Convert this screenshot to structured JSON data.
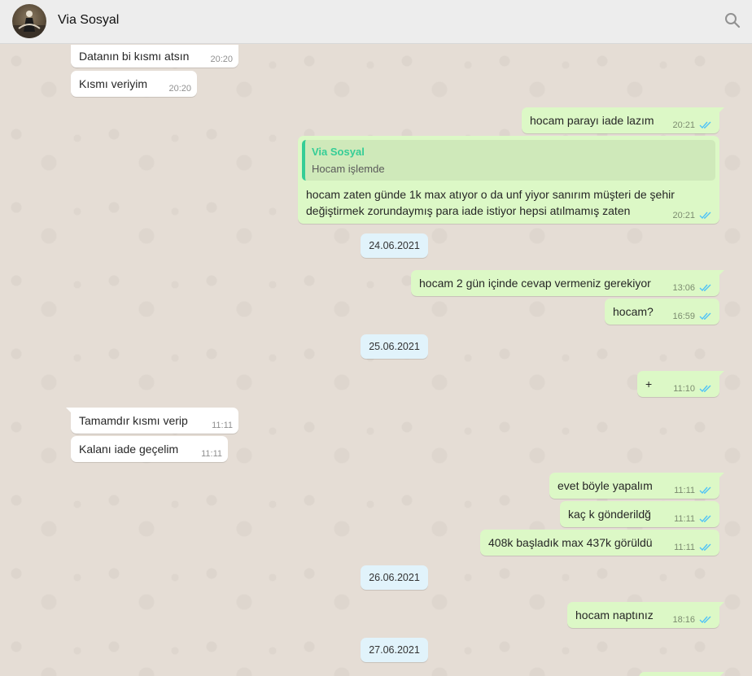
{
  "header": {
    "title": "Via Sosyal"
  },
  "messages": {
    "m1": {
      "text": "Datanın bi kısmı atsın",
      "time": "20:20"
    },
    "m2": {
      "text": "Kısmı veriyim",
      "time": "20:20"
    },
    "m3": {
      "text": "hocam parayı iade lazım",
      "time": "20:21"
    },
    "m4": {
      "quote_name": "Via Sosyal",
      "quote_text": "Hocam işlemde",
      "text": "hocam zaten günde 1k max atıyor o da unf yiyor sanırım müşteri de şehir değiştirmek zorundaymış para iade istiyor hepsi atılmamış zaten",
      "time": "20:21"
    },
    "m5": {
      "text": "hocam 2 gün içinde cevap vermeniz gerekiyor",
      "time": "13:06"
    },
    "m6": {
      "text": "hocam?",
      "time": "16:59"
    },
    "m7": {
      "text": "+",
      "time": "11:10"
    },
    "m8": {
      "text": "Tamamdır kısmı verip",
      "time": "11:11"
    },
    "m9": {
      "text": "Kalanı iade geçelim",
      "time": "11:11"
    },
    "m10": {
      "text": "evet böyle yapalım",
      "time": "11:11"
    },
    "m11": {
      "text": "kaç k gönderildğ",
      "time": "11:11"
    },
    "m12": {
      "text": "408k başladık max 437k görüldü",
      "time": "11:11"
    },
    "m13": {
      "text": "hocam naptınız",
      "time": "18:16"
    }
  },
  "dates": {
    "d1": "24.06.2021",
    "d2": "25.06.2021",
    "d3": "26.06.2021",
    "d4": "27.06.2021"
  },
  "colors": {
    "outgoing_bubble": "#dcf8c6",
    "incoming_bubble": "#ffffff",
    "date_chip": "#e1f3fb",
    "read_ticks": "#4fc3f7",
    "quote_accent": "#35cd96"
  }
}
